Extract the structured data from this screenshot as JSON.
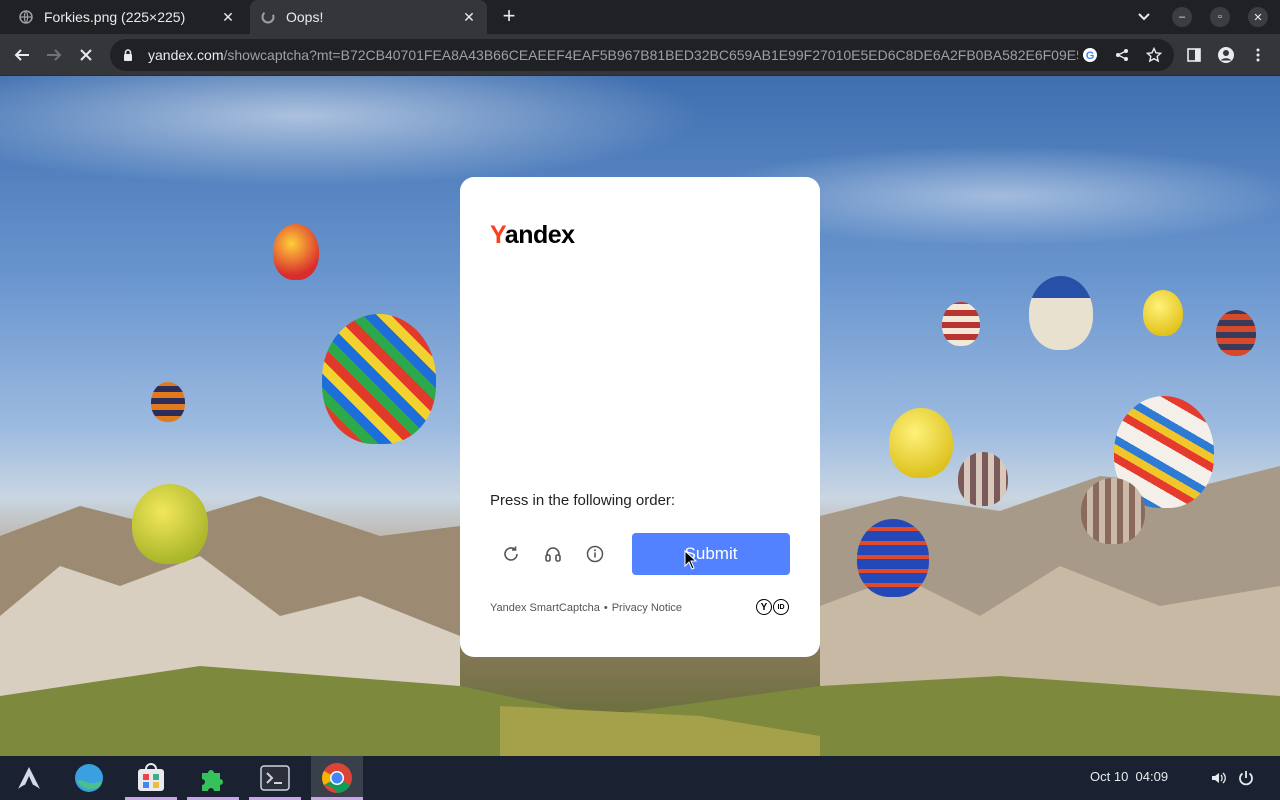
{
  "tabs": [
    {
      "title": "Forkies.png (225×225)",
      "icon": "globe-icon"
    },
    {
      "title": "Oops!",
      "icon": "loading-icon",
      "active": true
    }
  ],
  "toolbar": {
    "url_host": "yandex.com",
    "url_path": "/showcaptcha?mt=B72CB40701FEA8A43B66CEAEEF4EAF5B967B81BED32BC659AB1E99F27010E5ED6C8DE6A2FB0BA582E6F09E55..."
  },
  "captcha": {
    "logo_first": "Y",
    "logo_rest": "andex",
    "instruction": "Press in the following order:",
    "submit_label": "Submit",
    "footer_brand": "Yandex SmartCaptcha",
    "footer_separator": "•",
    "footer_privacy": "Privacy Notice",
    "badge_y": "Y",
    "badge_id": "ID"
  },
  "taskbar": {
    "date": "Oct 10",
    "time": "04:09",
    "apps": [
      "arch-menu-icon",
      "globe-icon",
      "store-icon",
      "puzzle-icon",
      "terminal-icon",
      "chrome-icon"
    ]
  },
  "colors": {
    "submit": "#5282ff",
    "yandex_red": "#fc3f1d"
  }
}
